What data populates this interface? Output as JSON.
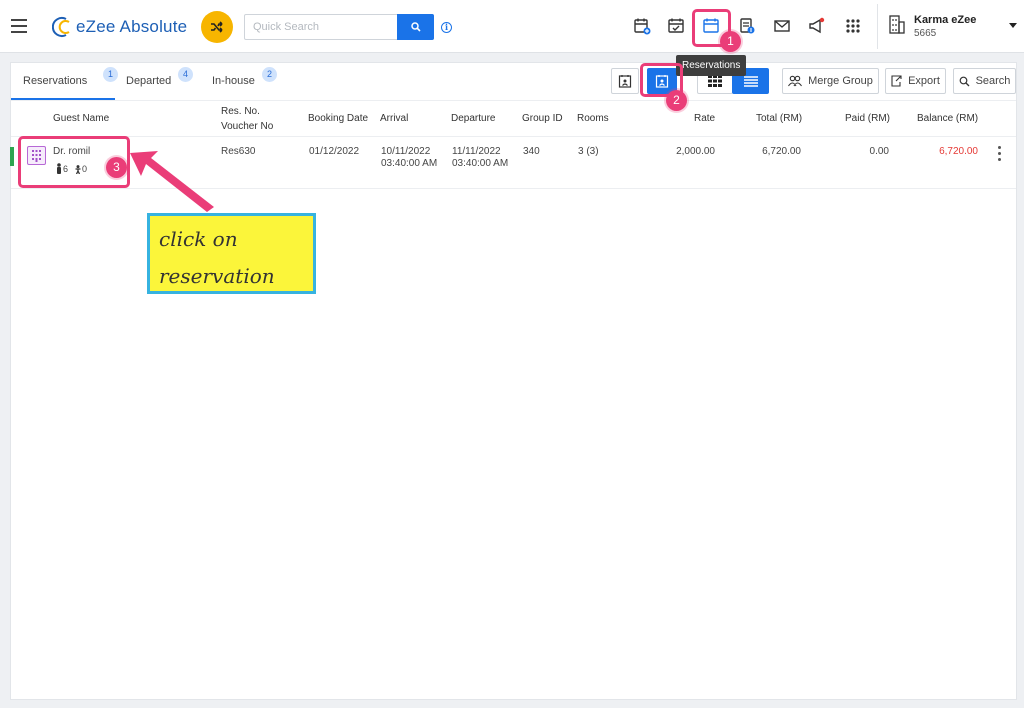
{
  "header": {
    "app_name": "eZee Absolute",
    "search_placeholder": "Quick Search",
    "property": {
      "name": "Karma eZee",
      "code": "5665"
    }
  },
  "tabs": [
    {
      "label": "Reservations",
      "count": "1"
    },
    {
      "label": "Departed",
      "count": "4"
    },
    {
      "label": "In-house",
      "count": "2"
    }
  ],
  "toolbar": {
    "merge_group_label": "Merge Group",
    "export_label": "Export",
    "search_label": "Search"
  },
  "table": {
    "headers": {
      "guest_name": "Guest Name",
      "res_no": "Res. No.",
      "voucher_no": "Voucher No",
      "booking_date": "Booking Date",
      "arrival": "Arrival",
      "departure": "Departure",
      "group_id": "Group ID",
      "rooms": "Rooms",
      "rate": "Rate",
      "total": "Total (RM)",
      "paid": "Paid (RM)",
      "balance": "Balance (RM)"
    },
    "rows": [
      {
        "guest_name": "Dr. romil",
        "adults": "6",
        "children": "0",
        "res_no": "Res630",
        "booking_date": "01/12/2022",
        "arrival_date": "10/11/2022",
        "arrival_time": "03:40:00 AM",
        "departure_date": "11/11/2022",
        "departure_time": "03:40:00 AM",
        "group_id": "340",
        "rooms": "3 (3)",
        "rate": "2,000.00",
        "total": "6,720.00",
        "paid": "0.00",
        "balance": "6,720.00"
      }
    ]
  },
  "annotations": {
    "tooltip": "Reservations",
    "step1": "1",
    "step2": "2",
    "step3": "3",
    "callout_line1": "click on",
    "callout_line2": "reservation"
  },
  "colors": {
    "accent": "#1a73e8",
    "highlight": "#ea3d78",
    "callout_bg": "#fbf53a",
    "callout_border": "#36b3e0",
    "balance_text": "#e53935",
    "shuffle_bg": "#f7b500"
  }
}
